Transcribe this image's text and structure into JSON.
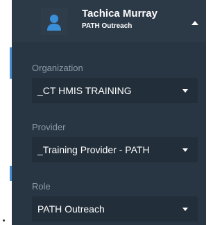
{
  "user": {
    "name": "Tachica Murray",
    "subtitle": "PATH Outreach",
    "avatar_icon": "user-avatar-icon",
    "menu_caret_icon": "caret-up-icon"
  },
  "fields": [
    {
      "label": "Organization",
      "value": "_CT HMIS TRAINING"
    },
    {
      "label": "Provider",
      "value": "_Training Provider - PATH"
    },
    {
      "label": "Role",
      "value": "PATH Outreach"
    }
  ],
  "colors": {
    "panel_bg": "#283542",
    "select_bg": "#222e39",
    "label_color": "#8c9aa8",
    "accent": "#4a8fd6"
  }
}
